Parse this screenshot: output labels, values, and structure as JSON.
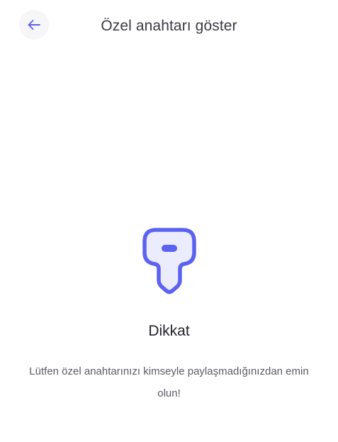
{
  "header": {
    "back_icon": "arrow-left-icon",
    "title": "Özel anahtarı göster"
  },
  "warning": {
    "icon": "key-icon",
    "title": "Dikkat",
    "message": "Lütfen özel anahtarınızı kimseyle paylaşmadığınızdan emin olun!"
  },
  "colors": {
    "accent": "#5b63f0",
    "icon_fill": "#ececff",
    "back_button_bg": "#f6f6f9"
  }
}
